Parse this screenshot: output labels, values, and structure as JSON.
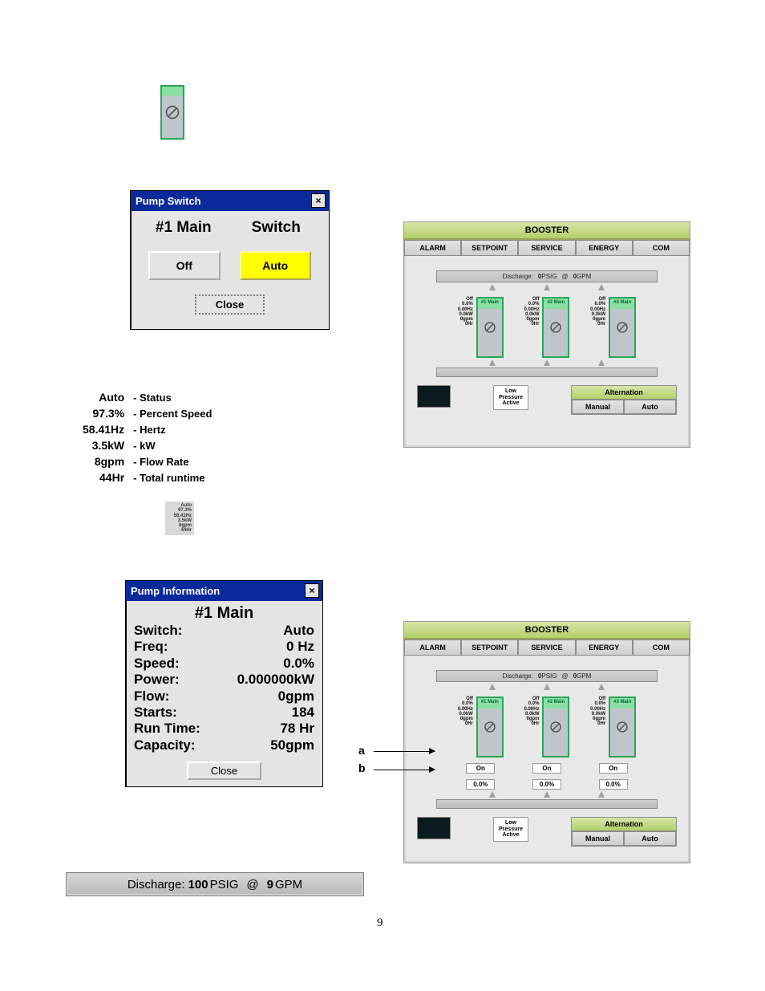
{
  "page_number": "9",
  "pump_switch_modal": {
    "title": "Pump Switch",
    "heading": "#1 Main",
    "heading_right": "Switch",
    "off_label": "Off",
    "auto_label": "Auto",
    "close_label": "Close"
  },
  "pump_stats": {
    "status": {
      "value": "Auto",
      "label": "- Status"
    },
    "percent_speed": {
      "value": "97.3%",
      "label": "- Percent Speed"
    },
    "hertz": {
      "value": "58.41Hz",
      "label": "- Hertz"
    },
    "kw": {
      "value": "3.5kW",
      "label": "- kW"
    },
    "flow_rate": {
      "value": "8gpm",
      "label": "- Flow Rate"
    },
    "total_runtime": {
      "value": "44Hr",
      "label": "- Total runtime"
    }
  },
  "mini_stats_lines": [
    "Auto",
    "97.3%",
    "58.41Hz",
    "3.5kW",
    "8gpm",
    "44Hr"
  ],
  "pump_info_modal": {
    "title": "Pump Information",
    "heading": "#1 Main",
    "rows": {
      "switch": {
        "k": "Switch:",
        "v": "Auto"
      },
      "freq": {
        "k": "Freq:",
        "v": "0 Hz"
      },
      "speed": {
        "k": "Speed:",
        "v": "0.0%"
      },
      "power": {
        "k": "Power:",
        "v": "0.000000kW"
      },
      "flow": {
        "k": "Flow:",
        "v": "0gpm"
      },
      "starts": {
        "k": "Starts:",
        "v": "184"
      },
      "run_time": {
        "k": "Run Time:",
        "v": "78 Hr"
      },
      "capacity": {
        "k": "Capacity:",
        "v": "50gpm"
      }
    },
    "close_label": "Close"
  },
  "booster_panel": {
    "title": "BOOSTER",
    "tabs": [
      "ALARM",
      "SETPOINT",
      "SERVICE",
      "ENERGY",
      "COM"
    ],
    "discharge": {
      "label": "Discharge:",
      "psig_value": "0",
      "psig_unit": "PSIG",
      "at": "@",
      "gpm_value": "0",
      "gpm_unit": "GPM"
    },
    "pump_labels": [
      "Off",
      "0.0%",
      "0.00Hz",
      "0.0kW",
      "0gpm",
      "0Hr"
    ],
    "pump_names": [
      "#1 Main",
      "#2 Main",
      "#3 Main"
    ],
    "low_pressure": {
      "line1": "Low",
      "line2": "Pressure",
      "line3": "Active"
    },
    "alternation": {
      "title": "Alternation",
      "manual": "Manual",
      "auto": "Auto"
    },
    "on_label": "On",
    "zero_pct": "0.0%"
  },
  "markers": {
    "a": "a",
    "b": "b"
  },
  "discharge_ribbon": {
    "label": "Discharge:",
    "psig_value": "100",
    "psig_unit": "PSIG",
    "at": "@",
    "gpm_value": "9",
    "gpm_unit": "GPM"
  }
}
